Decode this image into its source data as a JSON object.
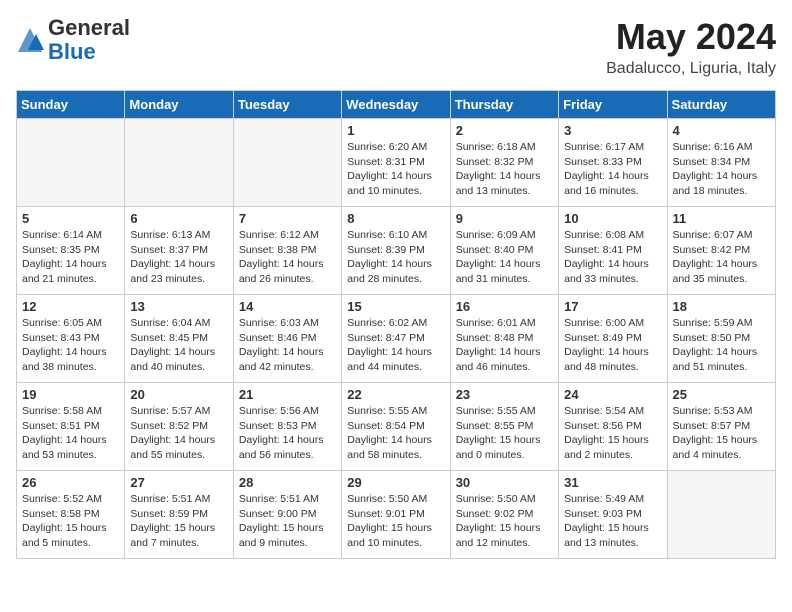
{
  "header": {
    "logo_general": "General",
    "logo_blue": "Blue",
    "month_title": "May 2024",
    "location": "Badalucco, Liguria, Italy"
  },
  "days_of_week": [
    "Sunday",
    "Monday",
    "Tuesday",
    "Wednesday",
    "Thursday",
    "Friday",
    "Saturday"
  ],
  "weeks": [
    [
      {
        "day": "",
        "empty": true
      },
      {
        "day": "",
        "empty": true
      },
      {
        "day": "",
        "empty": true
      },
      {
        "day": "1",
        "lines": [
          "Sunrise: 6:20 AM",
          "Sunset: 8:31 PM",
          "Daylight: 14 hours",
          "and 10 minutes."
        ]
      },
      {
        "day": "2",
        "lines": [
          "Sunrise: 6:18 AM",
          "Sunset: 8:32 PM",
          "Daylight: 14 hours",
          "and 13 minutes."
        ]
      },
      {
        "day": "3",
        "lines": [
          "Sunrise: 6:17 AM",
          "Sunset: 8:33 PM",
          "Daylight: 14 hours",
          "and 16 minutes."
        ]
      },
      {
        "day": "4",
        "lines": [
          "Sunrise: 6:16 AM",
          "Sunset: 8:34 PM",
          "Daylight: 14 hours",
          "and 18 minutes."
        ]
      }
    ],
    [
      {
        "day": "5",
        "lines": [
          "Sunrise: 6:14 AM",
          "Sunset: 8:35 PM",
          "Daylight: 14 hours",
          "and 21 minutes."
        ]
      },
      {
        "day": "6",
        "lines": [
          "Sunrise: 6:13 AM",
          "Sunset: 8:37 PM",
          "Daylight: 14 hours",
          "and 23 minutes."
        ]
      },
      {
        "day": "7",
        "lines": [
          "Sunrise: 6:12 AM",
          "Sunset: 8:38 PM",
          "Daylight: 14 hours",
          "and 26 minutes."
        ]
      },
      {
        "day": "8",
        "lines": [
          "Sunrise: 6:10 AM",
          "Sunset: 8:39 PM",
          "Daylight: 14 hours",
          "and 28 minutes."
        ]
      },
      {
        "day": "9",
        "lines": [
          "Sunrise: 6:09 AM",
          "Sunset: 8:40 PM",
          "Daylight: 14 hours",
          "and 31 minutes."
        ]
      },
      {
        "day": "10",
        "lines": [
          "Sunrise: 6:08 AM",
          "Sunset: 8:41 PM",
          "Daylight: 14 hours",
          "and 33 minutes."
        ]
      },
      {
        "day": "11",
        "lines": [
          "Sunrise: 6:07 AM",
          "Sunset: 8:42 PM",
          "Daylight: 14 hours",
          "and 35 minutes."
        ]
      }
    ],
    [
      {
        "day": "12",
        "lines": [
          "Sunrise: 6:05 AM",
          "Sunset: 8:43 PM",
          "Daylight: 14 hours",
          "and 38 minutes."
        ]
      },
      {
        "day": "13",
        "lines": [
          "Sunrise: 6:04 AM",
          "Sunset: 8:45 PM",
          "Daylight: 14 hours",
          "and 40 minutes."
        ]
      },
      {
        "day": "14",
        "lines": [
          "Sunrise: 6:03 AM",
          "Sunset: 8:46 PM",
          "Daylight: 14 hours",
          "and 42 minutes."
        ]
      },
      {
        "day": "15",
        "lines": [
          "Sunrise: 6:02 AM",
          "Sunset: 8:47 PM",
          "Daylight: 14 hours",
          "and 44 minutes."
        ]
      },
      {
        "day": "16",
        "lines": [
          "Sunrise: 6:01 AM",
          "Sunset: 8:48 PM",
          "Daylight: 14 hours",
          "and 46 minutes."
        ]
      },
      {
        "day": "17",
        "lines": [
          "Sunrise: 6:00 AM",
          "Sunset: 8:49 PM",
          "Daylight: 14 hours",
          "and 48 minutes."
        ]
      },
      {
        "day": "18",
        "lines": [
          "Sunrise: 5:59 AM",
          "Sunset: 8:50 PM",
          "Daylight: 14 hours",
          "and 51 minutes."
        ]
      }
    ],
    [
      {
        "day": "19",
        "lines": [
          "Sunrise: 5:58 AM",
          "Sunset: 8:51 PM",
          "Daylight: 14 hours",
          "and 53 minutes."
        ]
      },
      {
        "day": "20",
        "lines": [
          "Sunrise: 5:57 AM",
          "Sunset: 8:52 PM",
          "Daylight: 14 hours",
          "and 55 minutes."
        ]
      },
      {
        "day": "21",
        "lines": [
          "Sunrise: 5:56 AM",
          "Sunset: 8:53 PM",
          "Daylight: 14 hours",
          "and 56 minutes."
        ]
      },
      {
        "day": "22",
        "lines": [
          "Sunrise: 5:55 AM",
          "Sunset: 8:54 PM",
          "Daylight: 14 hours",
          "and 58 minutes."
        ]
      },
      {
        "day": "23",
        "lines": [
          "Sunrise: 5:55 AM",
          "Sunset: 8:55 PM",
          "Daylight: 15 hours",
          "and 0 minutes."
        ]
      },
      {
        "day": "24",
        "lines": [
          "Sunrise: 5:54 AM",
          "Sunset: 8:56 PM",
          "Daylight: 15 hours",
          "and 2 minutes."
        ]
      },
      {
        "day": "25",
        "lines": [
          "Sunrise: 5:53 AM",
          "Sunset: 8:57 PM",
          "Daylight: 15 hours",
          "and 4 minutes."
        ]
      }
    ],
    [
      {
        "day": "26",
        "lines": [
          "Sunrise: 5:52 AM",
          "Sunset: 8:58 PM",
          "Daylight: 15 hours",
          "and 5 minutes."
        ]
      },
      {
        "day": "27",
        "lines": [
          "Sunrise: 5:51 AM",
          "Sunset: 8:59 PM",
          "Daylight: 15 hours",
          "and 7 minutes."
        ]
      },
      {
        "day": "28",
        "lines": [
          "Sunrise: 5:51 AM",
          "Sunset: 9:00 PM",
          "Daylight: 15 hours",
          "and 9 minutes."
        ]
      },
      {
        "day": "29",
        "lines": [
          "Sunrise: 5:50 AM",
          "Sunset: 9:01 PM",
          "Daylight: 15 hours",
          "and 10 minutes."
        ]
      },
      {
        "day": "30",
        "lines": [
          "Sunrise: 5:50 AM",
          "Sunset: 9:02 PM",
          "Daylight: 15 hours",
          "and 12 minutes."
        ]
      },
      {
        "day": "31",
        "lines": [
          "Sunrise: 5:49 AM",
          "Sunset: 9:03 PM",
          "Daylight: 15 hours",
          "and 13 minutes."
        ]
      },
      {
        "day": "",
        "empty": true
      }
    ]
  ]
}
